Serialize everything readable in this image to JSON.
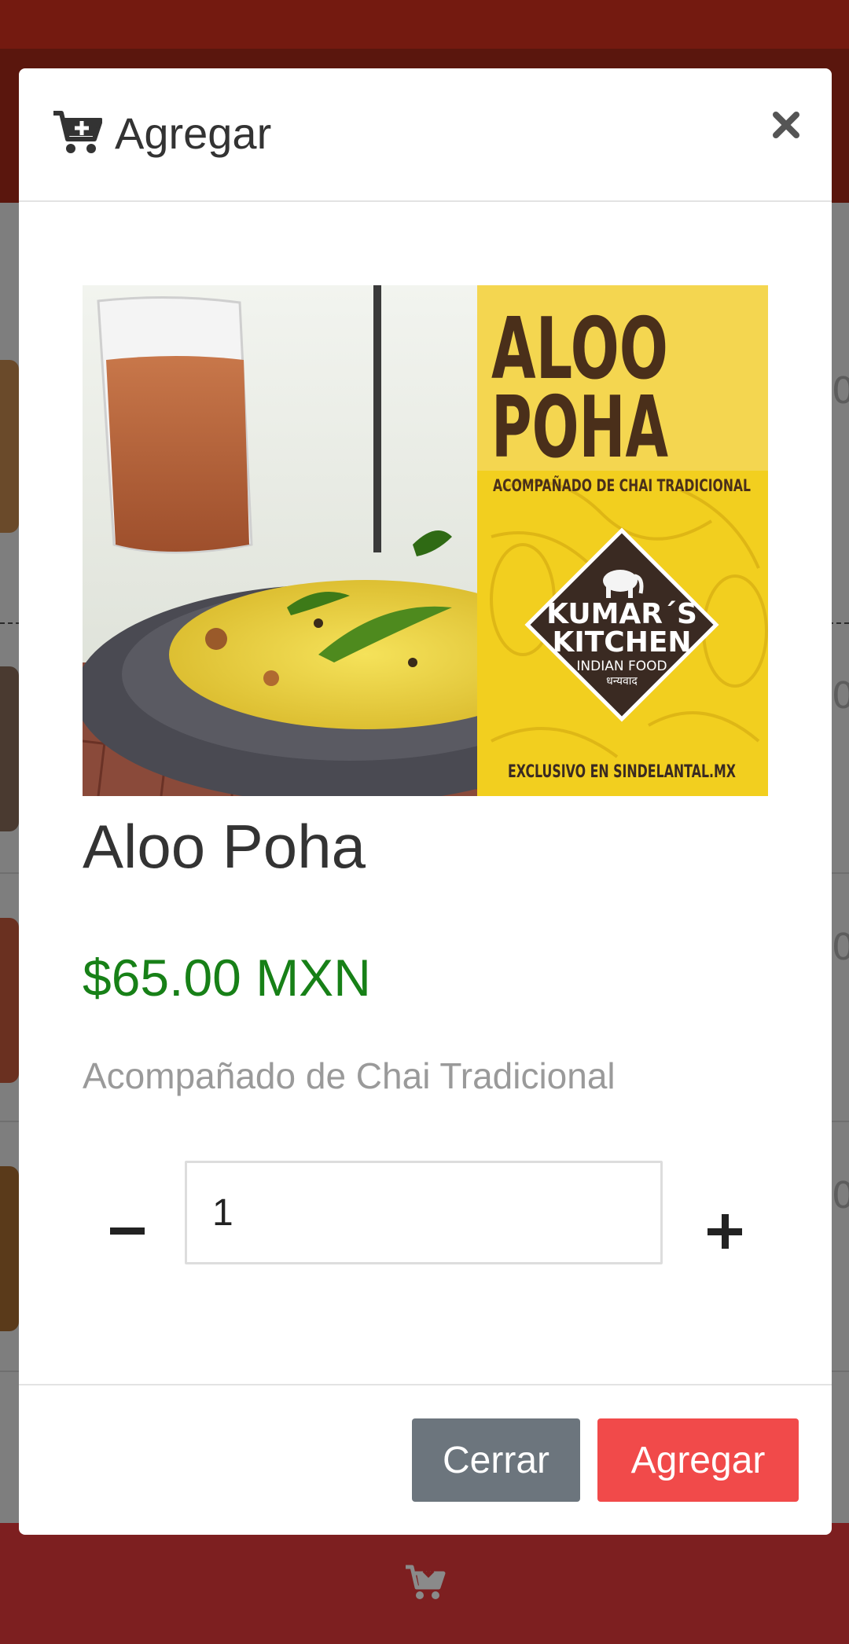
{
  "modal": {
    "title": "Agregar",
    "title_icon": "cart-plus-icon",
    "close_icon": "close-icon"
  },
  "product": {
    "name": "Aloo Poha",
    "price": "$65.00 MXN",
    "description": "Acompañado de Chai Tradicional",
    "image": {
      "headline_line1": "ALOO",
      "headline_line2": "POHA",
      "subtitle": "ACOMPAÑADO DE CHAI TRADICIONAL",
      "brand_line1": "KUMAR´S",
      "brand_line2": "KITCHEN",
      "brand_line3": "INDIAN FOOD",
      "brand_line4": "धन्यवाद",
      "footer": "EXCLUSIVO EN SINDELANTAL.MX"
    }
  },
  "quantity": {
    "value": "1",
    "decrement_icon": "minus-icon",
    "increment_icon": "plus-icon"
  },
  "footer": {
    "close_label": "Cerrar",
    "add_label": "Agregar"
  },
  "background": {
    "bottom_icon": "cart-download-icon"
  },
  "colors": {
    "price_green": "#178017",
    "add_button": "#f14a4a",
    "close_button": "#6c757d",
    "brand_dark_red": "#741a10",
    "bottom_bar": "#7d1f20",
    "poster_yellow": "#f2cf1f"
  }
}
